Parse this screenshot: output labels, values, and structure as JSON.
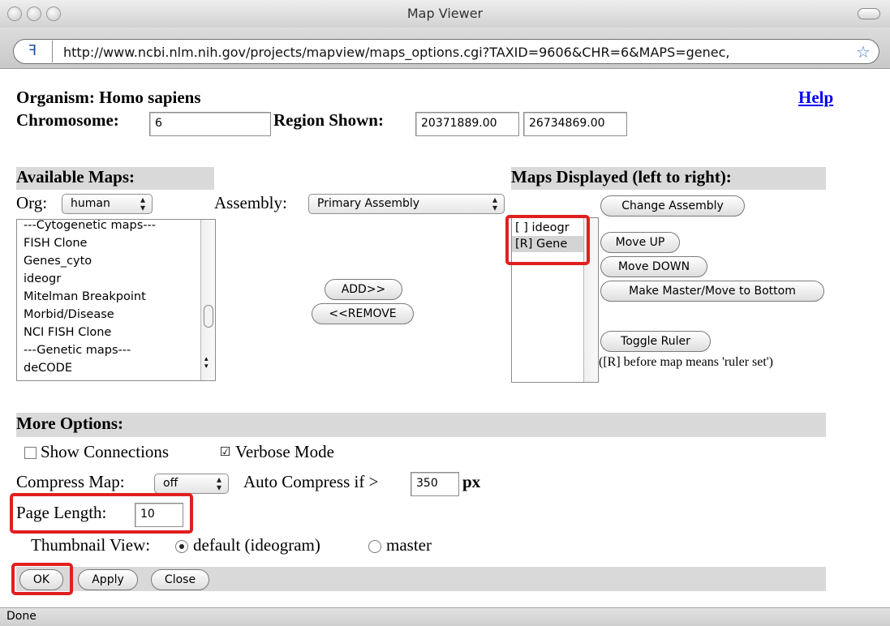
{
  "window": {
    "title": "Map Viewer"
  },
  "address": {
    "url": "http://www.ncbi.nlm.nih.gov/projects/mapview/maps_options.cgi?TAXID=9606&CHR=6&MAPS=genec,"
  },
  "organism": {
    "label": "Organism: Homo sapiens"
  },
  "help_link": "Help",
  "chromosome": {
    "label": "Chromosome:",
    "value": "6"
  },
  "region": {
    "label": "Region Shown:",
    "start": "20371889.00",
    "end": "26734869.00"
  },
  "available_maps": {
    "heading": "Available Maps:",
    "org_label": "Org:",
    "org_value": "human",
    "assembly_label": "Assembly:",
    "assembly_value": "Primary Assembly",
    "items": [
      "---Cytogenetic maps---",
      "FISH Clone",
      "Genes_cyto",
      "ideogr",
      "Mitelman Breakpoint",
      "Morbid/Disease",
      "NCI FISH Clone",
      "---Genetic maps---",
      "deCODE"
    ]
  },
  "buttons": {
    "add": "ADD>>",
    "remove": "<<REMOVE",
    "change_assembly": "Change Assembly",
    "move_up": "Move UP",
    "move_down": "Move DOWN",
    "make_master": "Make Master/Move to Bottom",
    "toggle_ruler": "Toggle Ruler",
    "ok": "OK",
    "apply": "Apply",
    "close": "Close"
  },
  "maps_displayed": {
    "heading": "Maps Displayed (left to right):",
    "items": [
      "[ ] ideogr",
      "[R] Gene"
    ],
    "ruler_note": "([R] before map means 'ruler set')"
  },
  "more_options": {
    "heading": "More Options:",
    "show_connections": "Show Connections",
    "show_connections_checked": false,
    "verbose_mode": "Verbose Mode",
    "verbose_mode_checked": true,
    "compress_label": "Compress Map:",
    "compress_value": "off",
    "auto_compress_label": "Auto Compress if >",
    "auto_compress_value": "350",
    "auto_compress_unit": "px",
    "page_length_label": "Page Length:",
    "page_length_value": "10",
    "thumbnail_label": "Thumbnail View:",
    "thumb_default": "default (ideogram)",
    "thumb_master": "master",
    "thumb_selected": "default (ideogram)"
  },
  "status": {
    "text": "Done"
  },
  "colors": {
    "highlight": "#e02020",
    "band": "#d9d9d9",
    "link": "#0000ee"
  }
}
